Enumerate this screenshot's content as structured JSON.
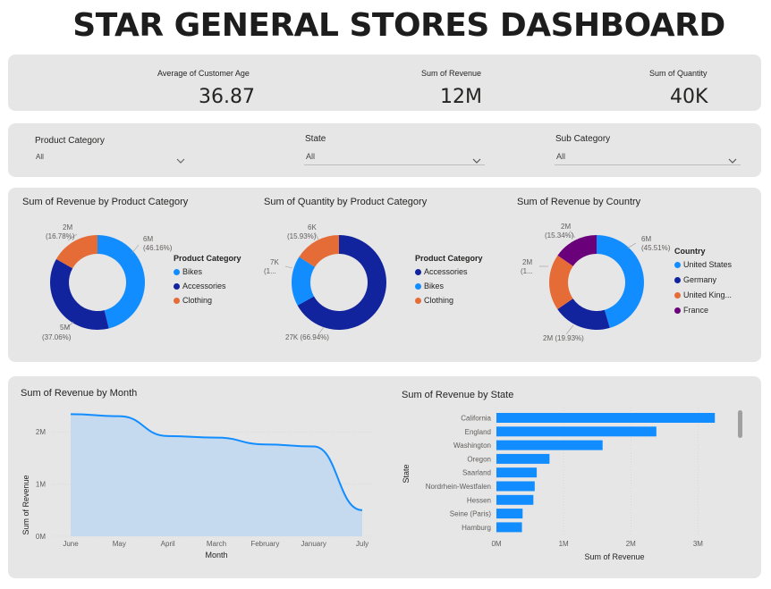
{
  "dashboard": {
    "title": "STAR GENERAL STORES DASHBOARD"
  },
  "kpis": [
    {
      "label": "Average of Customer Age",
      "value": "36.87"
    },
    {
      "label": "Sum of Revenue",
      "value": "12M"
    },
    {
      "label": "Sum of Quantity",
      "value": "40K"
    }
  ],
  "slicers": [
    {
      "label": "Product Category",
      "value": "All",
      "icon": "chevron-down-icon"
    },
    {
      "label": "State",
      "value": "All",
      "icon": "chevron-down-icon"
    },
    {
      "label": "Sub Category",
      "value": "All",
      "icon": "chevron-down-icon"
    }
  ],
  "colors": {
    "dark_blue": "#12239e",
    "light_blue": "#118dff",
    "orange": "#e66c37",
    "purple": "#6b007b",
    "area_fill": "#c5d9ef",
    "panel": "#e6e6e6"
  },
  "donuts": {
    "revenue_by_category": {
      "title": "Sum of Revenue by Product Category",
      "legend_title": "Product Category",
      "legend": [
        "Bikes",
        "Accessories",
        "Clothing"
      ],
      "labels": {
        "bikes": "6M",
        "bikes_pct": "(46.16%)",
        "accessories": "5M",
        "accessories_pct": "(37.06%)",
        "clothing": "2M",
        "clothing_pct": "(16.78%)"
      }
    },
    "quantity_by_category": {
      "title": "Sum of Quantity by Product Category",
      "legend_title": "Product Category",
      "legend": [
        "Accessories",
        "Bikes",
        "Clothing"
      ],
      "labels": {
        "accessories": "27K (66.94%)",
        "bikes": "7K",
        "bikes_pct": "(1...",
        "clothing": "6K",
        "clothing_pct": "(15.93%)"
      }
    },
    "revenue_by_country": {
      "title": "Sum of Revenue by Country",
      "legend_title": "Country",
      "legend": [
        "United States",
        "Germany",
        "United King...",
        "France"
      ],
      "labels": {
        "us": "6M",
        "us_pct": "(45.51%)",
        "germany": "2M (19.93%)",
        "uk": "2M",
        "uk_pct": "(1...",
        "france": "2M",
        "france_pct": "(15.34%)"
      }
    }
  },
  "line_chart": {
    "title": "Sum of Revenue by Month"
  },
  "bar_chart": {
    "title": "Sum of Revenue by State"
  },
  "chart_data": [
    {
      "type": "pie",
      "title": "Sum of Revenue by Product Category",
      "legend_title": "Product Category",
      "categories": [
        "Bikes",
        "Accessories",
        "Clothing"
      ],
      "values": [
        46.16,
        37.06,
        16.78
      ],
      "colors": [
        "#118dff",
        "#12239e",
        "#e66c37"
      ]
    },
    {
      "type": "pie",
      "title": "Sum of Quantity by Product Category",
      "legend_title": "Product Category",
      "categories": [
        "Accessories",
        "Bikes",
        "Clothing"
      ],
      "values": [
        66.94,
        17.13,
        15.93
      ],
      "colors": [
        "#12239e",
        "#118dff",
        "#e66c37"
      ]
    },
    {
      "type": "pie",
      "title": "Sum of Revenue by Country",
      "legend_title": "Country",
      "categories": [
        "United States",
        "Germany",
        "United King...",
        "France"
      ],
      "values": [
        45.51,
        19.93,
        19.22,
        15.34
      ],
      "colors": [
        "#118dff",
        "#12239e",
        "#e66c37",
        "#6b007b"
      ]
    },
    {
      "type": "area",
      "title": "Sum of Revenue by Month",
      "xlabel": "Month",
      "ylabel": "Sum of Revenue",
      "categories": [
        "June",
        "May",
        "April",
        "March",
        "February",
        "January",
        "July"
      ],
      "values": [
        2.34,
        2.3,
        1.92,
        1.89,
        1.76,
        1.72,
        0.5
      ],
      "ylim": [
        0,
        2.5
      ],
      "yticks": [
        0,
        1,
        2
      ],
      "ytick_labels": [
        "0M",
        "1M",
        "2M"
      ]
    },
    {
      "type": "bar",
      "orientation": "horizontal",
      "title": "Sum of Revenue by State",
      "xlabel": "Sum of Revenue",
      "ylabel": "State",
      "categories": [
        "California",
        "England",
        "Washington",
        "Oregon",
        "Saarland",
        "Nordrhein-Westfalen",
        "Hessen",
        "Seine (Paris)",
        "Hamburg"
      ],
      "values": [
        3.25,
        2.38,
        1.58,
        0.79,
        0.6,
        0.57,
        0.55,
        0.39,
        0.38
      ],
      "xlim": [
        0,
        3.5
      ],
      "xticks": [
        0,
        1,
        2,
        3
      ],
      "xtick_labels": [
        "0M",
        "1M",
        "2M",
        "3M"
      ]
    }
  ]
}
